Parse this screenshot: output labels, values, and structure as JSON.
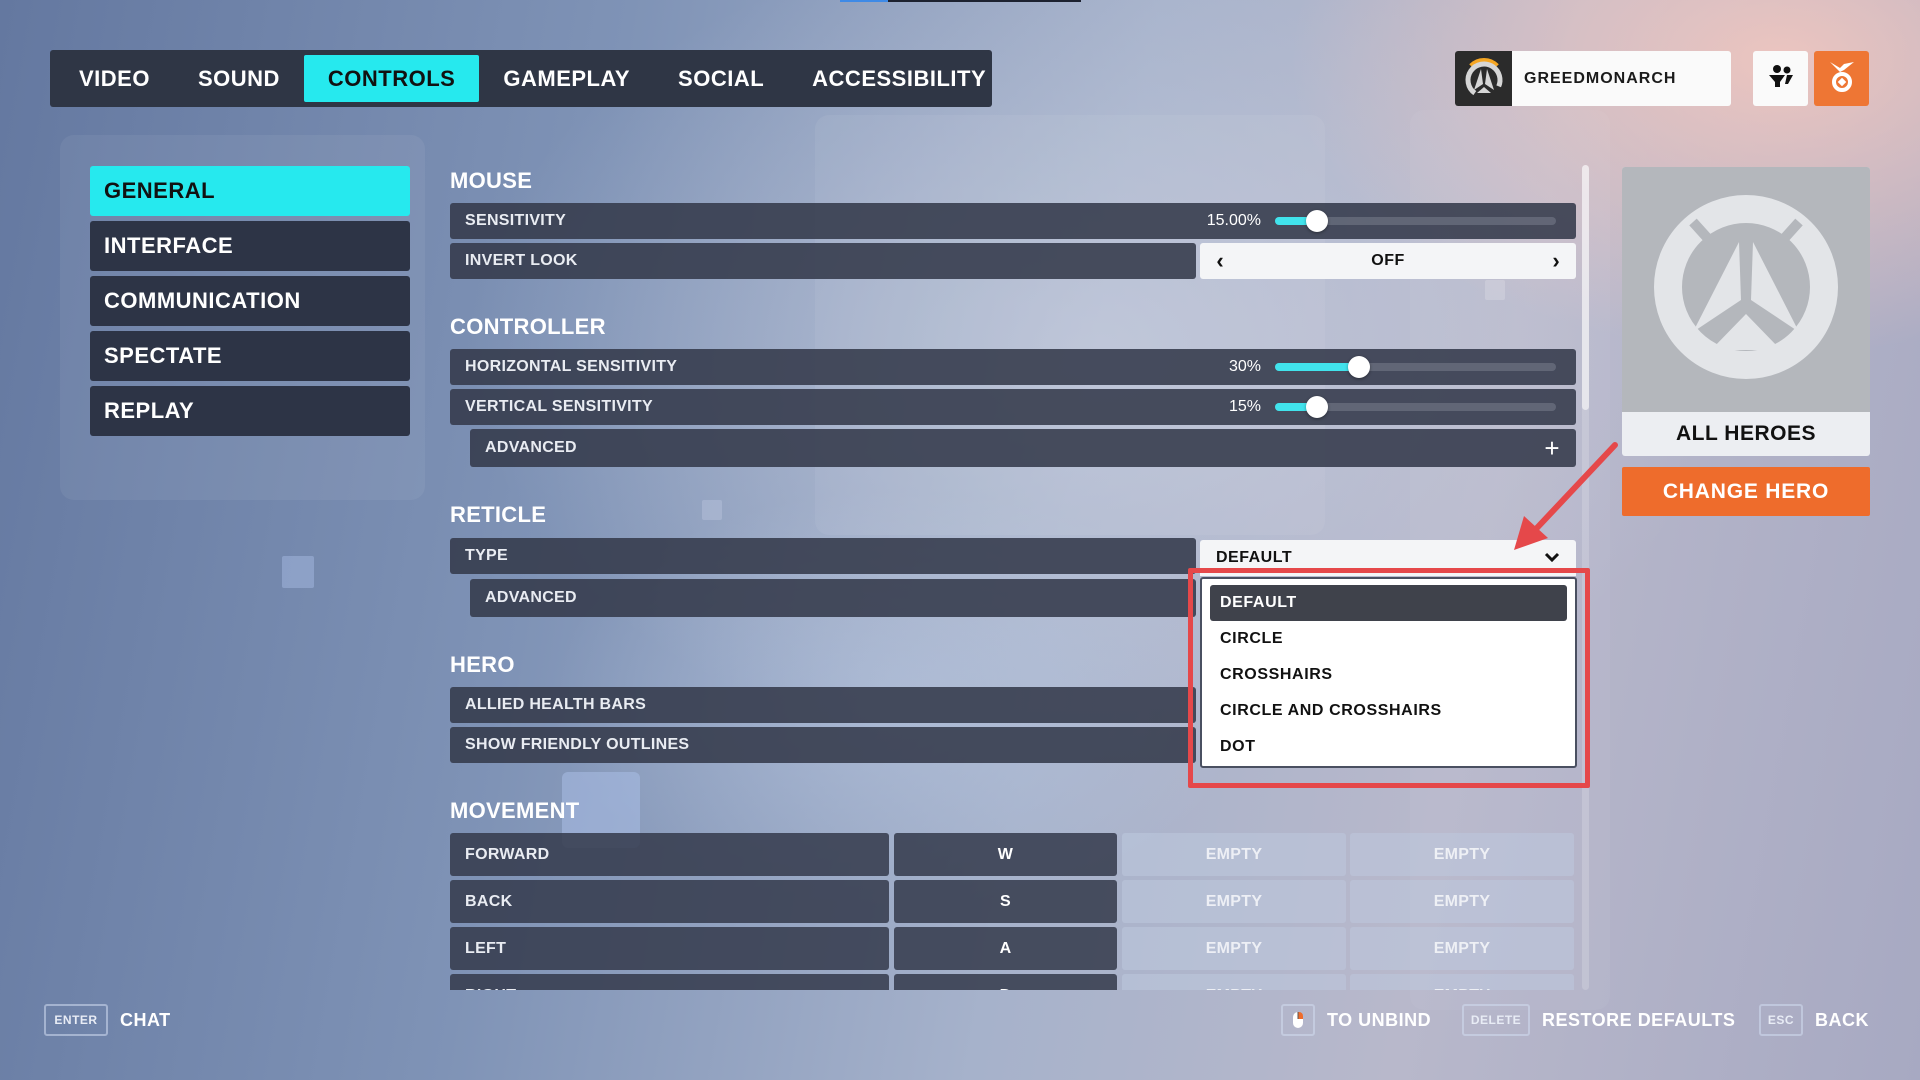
{
  "loading_bar": {
    "progress_percent": 20
  },
  "nav": {
    "tabs": [
      {
        "label": "VIDEO",
        "active": false
      },
      {
        "label": "SOUND",
        "active": false
      },
      {
        "label": "CONTROLS",
        "active": true
      },
      {
        "label": "GAMEPLAY",
        "active": false
      },
      {
        "label": "SOCIAL",
        "active": false
      },
      {
        "label": "ACCESSIBILITY",
        "active": false
      }
    ]
  },
  "player": {
    "name": "GREEDMONARCH",
    "emblem_icon": "overwatch-logo-icon",
    "social_icon": "group-icon",
    "challenges_icon": "medal-icon"
  },
  "sidebar": {
    "items": [
      {
        "label": "GENERAL",
        "active": true
      },
      {
        "label": "INTERFACE",
        "active": false
      },
      {
        "label": "COMMUNICATION",
        "active": false
      },
      {
        "label": "SPECTATE",
        "active": false
      },
      {
        "label": "REPLAY",
        "active": false
      }
    ]
  },
  "mouse": {
    "title": "MOUSE",
    "sensitivity": {
      "label": "SENSITIVITY",
      "value_text": "15.00%",
      "value": 15
    },
    "invert_look": {
      "label": "INVERT LOOK",
      "value": "OFF"
    }
  },
  "controller": {
    "title": "CONTROLLER",
    "horizontal": {
      "label": "HORIZONTAL SENSITIVITY",
      "value_text": "30%",
      "value": 30
    },
    "vertical": {
      "label": "VERTICAL SENSITIVITY",
      "value_text": "15%",
      "value": 15
    },
    "advanced": {
      "label": "ADVANCED",
      "expand_icon": "plus-icon"
    }
  },
  "reticle": {
    "title": "RETICLE",
    "type": {
      "label": "TYPE",
      "value": "DEFAULT"
    },
    "advanced": {
      "label": "ADVANCED"
    },
    "options": [
      {
        "label": "DEFAULT",
        "selected": true
      },
      {
        "label": "CIRCLE",
        "selected": false
      },
      {
        "label": "CROSSHAIRS",
        "selected": false
      },
      {
        "label": "CIRCLE AND CROSSHAIRS",
        "selected": false
      },
      {
        "label": "DOT",
        "selected": false
      }
    ]
  },
  "hero": {
    "title": "HERO",
    "allied_health_bars": {
      "label": "ALLIED HEALTH BARS"
    },
    "show_friendly_outlines": {
      "label": "SHOW FRIENDLY OUTLINES"
    }
  },
  "movement": {
    "title": "MOVEMENT",
    "rows": [
      {
        "action": "FORWARD",
        "key": "W",
        "alt1": "EMPTY",
        "alt2": "EMPTY"
      },
      {
        "action": "BACK",
        "key": "S",
        "alt1": "EMPTY",
        "alt2": "EMPTY"
      },
      {
        "action": "LEFT",
        "key": "A",
        "alt1": "EMPTY",
        "alt2": "EMPTY"
      },
      {
        "action": "RIGHT",
        "key": "D",
        "alt1": "EMPTY",
        "alt2": "EMPTY"
      }
    ]
  },
  "hero_panel": {
    "label": "ALL HEROES",
    "button": "CHANGE HERO"
  },
  "footer": {
    "chat": {
      "key": "ENTER",
      "label": "CHAT"
    },
    "unbind": {
      "key_icon": "mouse-right-click-icon",
      "label": "TO UNBIND"
    },
    "restore": {
      "key": "DELETE",
      "label": "RESTORE DEFAULTS"
    },
    "back": {
      "key": "ESC",
      "label": "BACK"
    }
  },
  "colors": {
    "accent_cyan": "#26e9ee",
    "accent_orange": "#ee6c2c",
    "annotation_red": "#e5484a",
    "panel_dark": "#2f3645"
  }
}
